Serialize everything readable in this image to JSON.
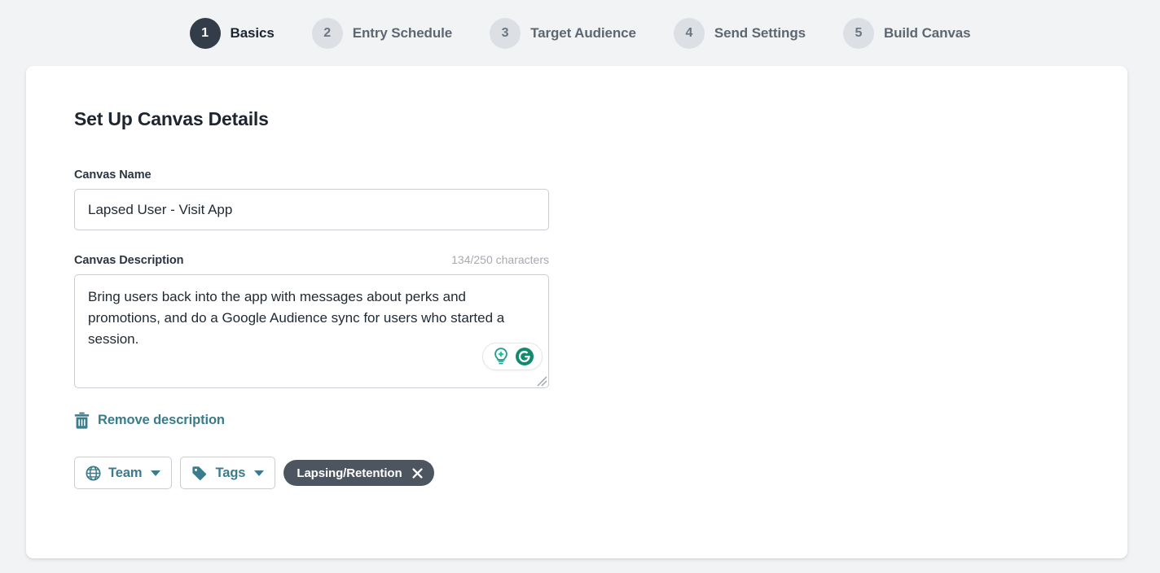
{
  "stepper": {
    "steps": [
      {
        "number": "1",
        "label": "Basics",
        "state": "active"
      },
      {
        "number": "2",
        "label": "Entry Schedule",
        "state": "inactive"
      },
      {
        "number": "3",
        "label": "Target Audience",
        "state": "inactive"
      },
      {
        "number": "4",
        "label": "Send Settings",
        "state": "inactive"
      },
      {
        "number": "5",
        "label": "Build Canvas",
        "state": "inactive"
      }
    ]
  },
  "card": {
    "title": "Set Up Canvas Details",
    "name_field": {
      "label": "Canvas Name",
      "value": "Lapsed User - Visit App",
      "placeholder": "Canvas Name"
    },
    "description_field": {
      "label": "Canvas Description",
      "char_count": "134/250 characters",
      "value": "Bring users back into the app with messages about perks and promotions, and do a Google Audience sync for users who started a session.",
      "placeholder": "Canvas Description"
    },
    "remove_description": {
      "label": "Remove description",
      "icon": "trash-icon"
    },
    "controls": {
      "team_dropdown": {
        "label": "Team",
        "icon": "globe-icon",
        "caret": "chevron-down-icon"
      },
      "tags_dropdown": {
        "label": "Tags",
        "icon": "tag-icon",
        "caret": "chevron-down-icon"
      },
      "tags": [
        {
          "label": "Lapsing/Retention",
          "remove_icon": "close-icon"
        }
      ]
    },
    "grammarly": {
      "assistant_icon": "lightbulb-icon",
      "brand_icon": "grammarly-g-icon"
    }
  },
  "colors": {
    "page_background": "#f2f3f5",
    "card_background": "#ffffff",
    "active_step": "#333d49",
    "inactive_step": "#dcdfe3",
    "accent_teal": "#3a7b8c",
    "tag_pill": "#4d5660",
    "text_primary": "#1c2530",
    "text_muted": "#a5abb3",
    "border": "#c9ced4",
    "grammarly_green": "#15c39a",
    "grammarly_dark_green": "#0e8a6a"
  }
}
